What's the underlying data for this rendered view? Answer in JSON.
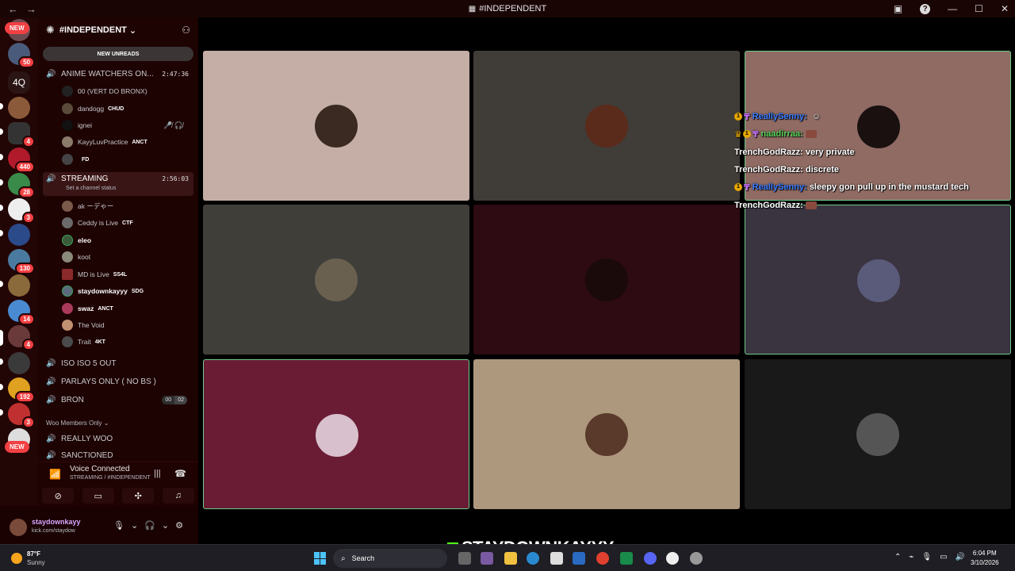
{
  "window": {
    "title": "#INDEPENDENT",
    "back": "←",
    "forward": "→",
    "controls": {
      "minimize": "—",
      "maximize": "☐",
      "close": "✕",
      "help": "?"
    }
  },
  "rail": {
    "new_top": "NEW",
    "new_bottom": "NEW",
    "folder_label": "4Q",
    "badges": [
      "50",
      "4",
      "440",
      "28",
      "3",
      "130",
      "14",
      "4",
      "192",
      "3"
    ]
  },
  "server": {
    "name": "#INDEPENDENT",
    "new_unreads": "NEW UNREADS"
  },
  "channels": [
    {
      "name": "ANIME WATCHERS ON...",
      "timer": "2:47:36"
    },
    {
      "name": "STREAMING",
      "timer": "2:56:03",
      "status": "Set a channel status"
    },
    {
      "name": "ISO ISO 5 OUT"
    },
    {
      "name": "PARLAYS ONLY ( NO BS )"
    },
    {
      "name": "BRON",
      "count_a": "00",
      "count_b": "02"
    },
    {
      "name": "REALLY WOO"
    },
    {
      "name": "SANCTIONED"
    }
  ],
  "category_woo": "Woo Members Only",
  "anime_members": [
    {
      "name": "00 (VERT DO BRONX)"
    },
    {
      "name": "dandogg",
      "tag": "CHUD"
    },
    {
      "name": "ignei",
      "icons": "🎤̸ 🎧̸"
    },
    {
      "name": "KayyLuvPractice",
      "tag": "ANCT"
    },
    {
      "name": "",
      "tag": "FD"
    }
  ],
  "streaming_members": [
    {
      "name": "ak ーデゃー"
    },
    {
      "name": "Ceddy is Live",
      "tag": "CTF"
    },
    {
      "name": "eleo"
    },
    {
      "name": "koot"
    },
    {
      "name": "MD is Live",
      "tag": "SS4L"
    },
    {
      "name": "staydownkayyy",
      "tag": "SDG"
    },
    {
      "name": "swaz",
      "tag": "ANCT"
    },
    {
      "name": "The Void"
    },
    {
      "name": "Trait",
      "tag": "4KT"
    }
  ],
  "voice": {
    "status": "Voice Connected",
    "location": "STREAMING / #INDEPENDENT"
  },
  "user": {
    "name": "staydownkayy",
    "sub": "kick.com/staydow"
  },
  "chat": [
    {
      "badge": "1",
      "user": "ReallySenny:",
      "user_color": "blue",
      "msg": ""
    },
    {
      "crown": true,
      "badge": "1",
      "user": "naadirraa:",
      "user_color": "green",
      "msg": ""
    },
    {
      "user": "TrenchGodRazz:",
      "user_color": "white",
      "msg": "very private"
    },
    {
      "user": "TrenchGodRazz:",
      "user_color": "white",
      "msg": "discrete"
    },
    {
      "badge": "1",
      "user": "ReallySenny:",
      "user_color": "blue",
      "msg": "sleepy gon pull up in the mustard tech"
    },
    {
      "user": "TrenchGodRazz:",
      "user_color": "white",
      "msg": ""
    }
  ],
  "watermark": "STAYDOWNKAYYY",
  "taskbar": {
    "temp": "87°F",
    "weather": "Sunny",
    "search_placeholder": "Search",
    "time": "6:04 PM",
    "date": "3/10/2026"
  },
  "colors": {
    "tiles": [
      "#c4aea5",
      "#403c37",
      "#8f6b63",
      "#403e39",
      "#2e0a12",
      "#3a3340",
      "#6a1c35",
      "#ad977d",
      "#191919"
    ],
    "speaking": "#6ecb8a"
  }
}
